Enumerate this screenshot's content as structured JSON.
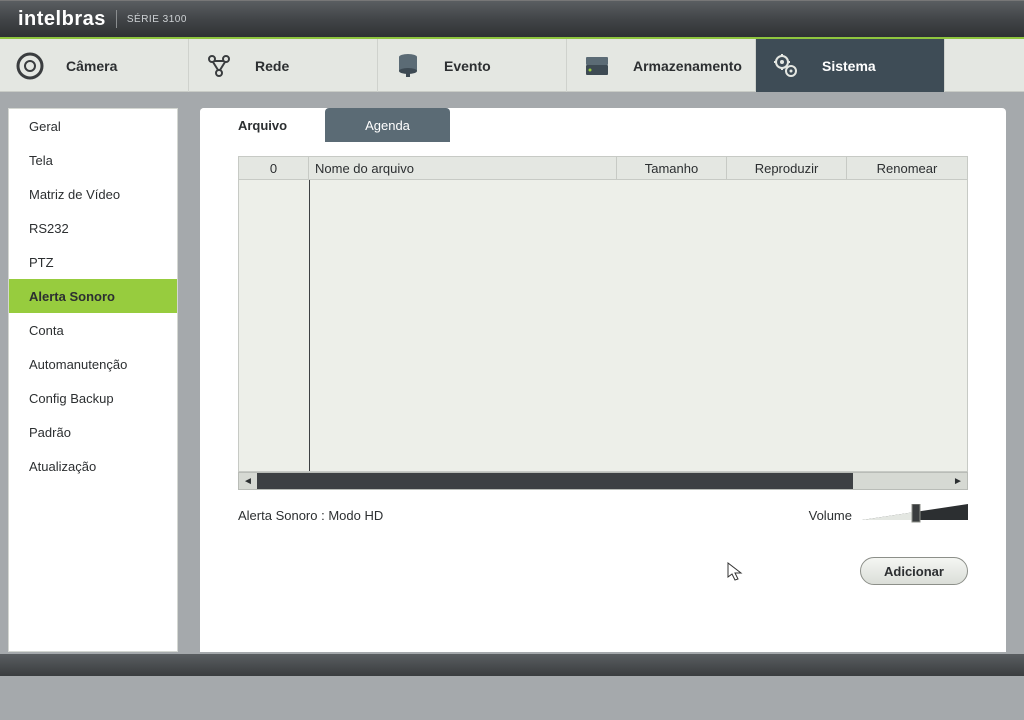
{
  "header": {
    "brand": "intelbras",
    "series": "SÉRIE 3100"
  },
  "nav": {
    "items": [
      {
        "label": "Câmera"
      },
      {
        "label": "Rede"
      },
      {
        "label": "Evento"
      },
      {
        "label": "Armazenamento"
      },
      {
        "label": "Sistema"
      }
    ]
  },
  "sidebar": {
    "items": [
      {
        "label": "Geral"
      },
      {
        "label": "Tela"
      },
      {
        "label": "Matriz de Vídeo"
      },
      {
        "label": "RS232"
      },
      {
        "label": "PTZ"
      },
      {
        "label": "Alerta Sonoro"
      },
      {
        "label": "Conta"
      },
      {
        "label": "Automanutenção"
      },
      {
        "label": "Config Backup"
      },
      {
        "label": "Padrão"
      },
      {
        "label": "Atualização"
      }
    ]
  },
  "tabs": {
    "arquivo": "Arquivo",
    "agenda": "Agenda"
  },
  "table": {
    "count": "0",
    "col_name": "Nome do arquivo",
    "col_size": "Tamanho",
    "col_play": "Reproduzir",
    "col_rename": "Renomear"
  },
  "status": {
    "alerta_label": "Alerta Sonoro : Modo HD",
    "volume_label": "Volume"
  },
  "buttons": {
    "add": "Adicionar"
  }
}
